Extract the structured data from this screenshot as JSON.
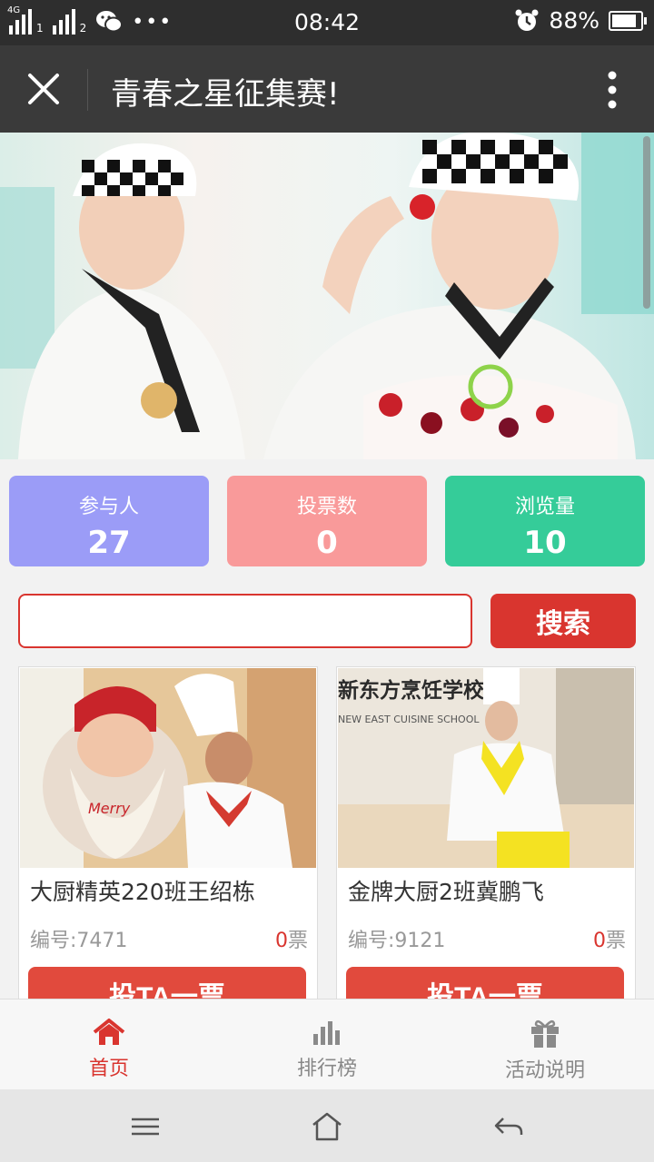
{
  "status": {
    "network1": "4G",
    "sim1": "1",
    "sim2": "2",
    "time": "08:42",
    "battery": "88%",
    "battery_level": 0.88
  },
  "header": {
    "title": "青春之星征集赛!"
  },
  "stats": [
    {
      "label": "参与人",
      "value": "27",
      "color": "#9b9cf7"
    },
    {
      "label": "投票数",
      "value": "0",
      "color": "#f99a9a"
    },
    {
      "label": "浏览量",
      "value": "10",
      "color": "#35cc99"
    }
  ],
  "search": {
    "value": "",
    "button_label": "搜索"
  },
  "entries": [
    {
      "name": "大厨精英220班王绍栋",
      "number_label": "编号:7471",
      "votes": "0",
      "votes_unit": "票",
      "vote_label": "投TA一票"
    },
    {
      "name": "金牌大厨2班冀鹏飞",
      "number_label": "编号:9121",
      "votes": "0",
      "votes_unit": "票",
      "vote_label": "投TA一票"
    }
  ],
  "photo2": {
    "school_cn": "新东方烹饪学校",
    "school_en": "NEW EAST CUISINE SCHOOL"
  },
  "tabs": [
    {
      "label": "首页",
      "icon": "home-icon",
      "active": true
    },
    {
      "label": "排行榜",
      "icon": "bar-chart-icon",
      "active": false
    },
    {
      "label": "活动说明",
      "icon": "gift-icon",
      "active": false
    }
  ],
  "colors": {
    "accent": "#d9352f",
    "title_bar": "#3a3a3a",
    "status_bar": "#2e2e2e"
  }
}
